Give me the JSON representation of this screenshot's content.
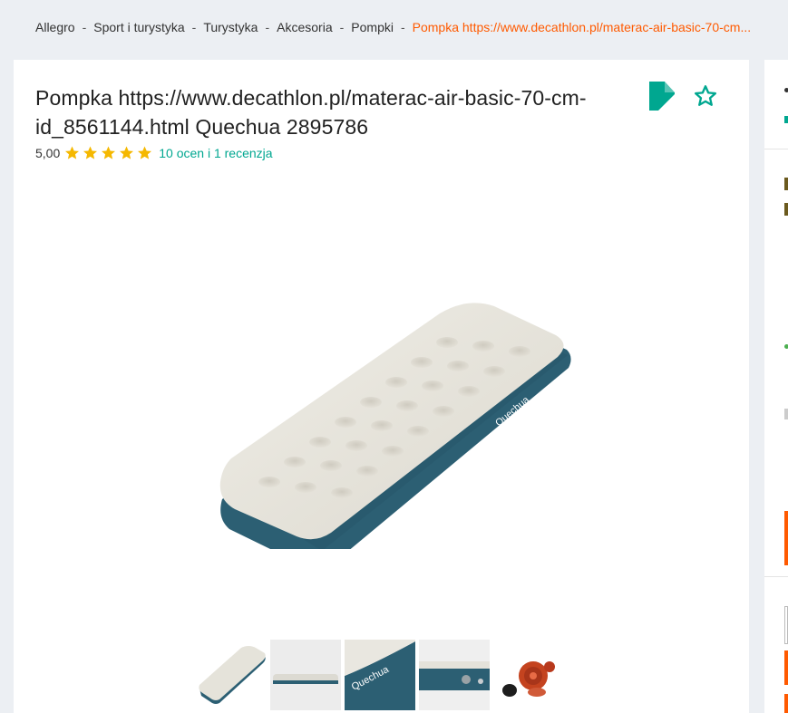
{
  "breadcrumb": {
    "items": [
      "Allegro",
      "Sport i turystyka",
      "Turystyka",
      "Akcesoria",
      "Pompki"
    ],
    "current": "Pompka https://www.decathlon.pl/materac-air-basic-70-cm...",
    "separator": "-"
  },
  "product": {
    "title": "Pompka https://www.decathlon.pl/materac-air-basic-70-cm-id_8561144.html Quechua 2895786",
    "rating_value": "5,00",
    "stars": 5,
    "rating_link": "10 ocen i 1 recenzja",
    "image_brand_text": "Quechua"
  },
  "thumbnails": [
    "mattress-top-view",
    "mattress-side-view",
    "mattress-logo-closeup",
    "mattress-valve-closeup",
    "pump-accessory"
  ],
  "colors": {
    "accent": "#00a790",
    "orange": "#ff5a00",
    "star": "#f5b800",
    "mattress_top": "#e7e5dd",
    "mattress_side": "#2c5f73"
  },
  "icons": {
    "brand_badge": "brand-badge-icon",
    "favorite": "star-outline-icon"
  }
}
